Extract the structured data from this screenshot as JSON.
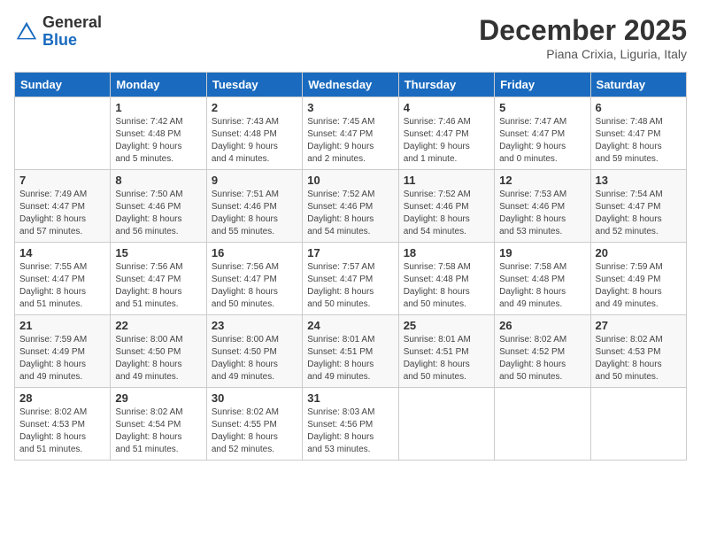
{
  "header": {
    "logo_line1": "General",
    "logo_line2": "Blue",
    "month_title": "December 2025",
    "location": "Piana Crixia, Liguria, Italy"
  },
  "days_of_week": [
    "Sunday",
    "Monday",
    "Tuesday",
    "Wednesday",
    "Thursday",
    "Friday",
    "Saturday"
  ],
  "weeks": [
    [
      {
        "day": "",
        "info": ""
      },
      {
        "day": "1",
        "info": "Sunrise: 7:42 AM\nSunset: 4:48 PM\nDaylight: 9 hours\nand 5 minutes."
      },
      {
        "day": "2",
        "info": "Sunrise: 7:43 AM\nSunset: 4:48 PM\nDaylight: 9 hours\nand 4 minutes."
      },
      {
        "day": "3",
        "info": "Sunrise: 7:45 AM\nSunset: 4:47 PM\nDaylight: 9 hours\nand 2 minutes."
      },
      {
        "day": "4",
        "info": "Sunrise: 7:46 AM\nSunset: 4:47 PM\nDaylight: 9 hours\nand 1 minute."
      },
      {
        "day": "5",
        "info": "Sunrise: 7:47 AM\nSunset: 4:47 PM\nDaylight: 9 hours\nand 0 minutes."
      },
      {
        "day": "6",
        "info": "Sunrise: 7:48 AM\nSunset: 4:47 PM\nDaylight: 8 hours\nand 59 minutes."
      }
    ],
    [
      {
        "day": "7",
        "info": "Sunrise: 7:49 AM\nSunset: 4:47 PM\nDaylight: 8 hours\nand 57 minutes."
      },
      {
        "day": "8",
        "info": "Sunrise: 7:50 AM\nSunset: 4:46 PM\nDaylight: 8 hours\nand 56 minutes."
      },
      {
        "day": "9",
        "info": "Sunrise: 7:51 AM\nSunset: 4:46 PM\nDaylight: 8 hours\nand 55 minutes."
      },
      {
        "day": "10",
        "info": "Sunrise: 7:52 AM\nSunset: 4:46 PM\nDaylight: 8 hours\nand 54 minutes."
      },
      {
        "day": "11",
        "info": "Sunrise: 7:52 AM\nSunset: 4:46 PM\nDaylight: 8 hours\nand 54 minutes."
      },
      {
        "day": "12",
        "info": "Sunrise: 7:53 AM\nSunset: 4:46 PM\nDaylight: 8 hours\nand 53 minutes."
      },
      {
        "day": "13",
        "info": "Sunrise: 7:54 AM\nSunset: 4:47 PM\nDaylight: 8 hours\nand 52 minutes."
      }
    ],
    [
      {
        "day": "14",
        "info": "Sunrise: 7:55 AM\nSunset: 4:47 PM\nDaylight: 8 hours\nand 51 minutes."
      },
      {
        "day": "15",
        "info": "Sunrise: 7:56 AM\nSunset: 4:47 PM\nDaylight: 8 hours\nand 51 minutes."
      },
      {
        "day": "16",
        "info": "Sunrise: 7:56 AM\nSunset: 4:47 PM\nDaylight: 8 hours\nand 50 minutes."
      },
      {
        "day": "17",
        "info": "Sunrise: 7:57 AM\nSunset: 4:47 PM\nDaylight: 8 hours\nand 50 minutes."
      },
      {
        "day": "18",
        "info": "Sunrise: 7:58 AM\nSunset: 4:48 PM\nDaylight: 8 hours\nand 50 minutes."
      },
      {
        "day": "19",
        "info": "Sunrise: 7:58 AM\nSunset: 4:48 PM\nDaylight: 8 hours\nand 49 minutes."
      },
      {
        "day": "20",
        "info": "Sunrise: 7:59 AM\nSunset: 4:49 PM\nDaylight: 8 hours\nand 49 minutes."
      }
    ],
    [
      {
        "day": "21",
        "info": "Sunrise: 7:59 AM\nSunset: 4:49 PM\nDaylight: 8 hours\nand 49 minutes."
      },
      {
        "day": "22",
        "info": "Sunrise: 8:00 AM\nSunset: 4:50 PM\nDaylight: 8 hours\nand 49 minutes."
      },
      {
        "day": "23",
        "info": "Sunrise: 8:00 AM\nSunset: 4:50 PM\nDaylight: 8 hours\nand 49 minutes."
      },
      {
        "day": "24",
        "info": "Sunrise: 8:01 AM\nSunset: 4:51 PM\nDaylight: 8 hours\nand 49 minutes."
      },
      {
        "day": "25",
        "info": "Sunrise: 8:01 AM\nSunset: 4:51 PM\nDaylight: 8 hours\nand 50 minutes."
      },
      {
        "day": "26",
        "info": "Sunrise: 8:02 AM\nSunset: 4:52 PM\nDaylight: 8 hours\nand 50 minutes."
      },
      {
        "day": "27",
        "info": "Sunrise: 8:02 AM\nSunset: 4:53 PM\nDaylight: 8 hours\nand 50 minutes."
      }
    ],
    [
      {
        "day": "28",
        "info": "Sunrise: 8:02 AM\nSunset: 4:53 PM\nDaylight: 8 hours\nand 51 minutes."
      },
      {
        "day": "29",
        "info": "Sunrise: 8:02 AM\nSunset: 4:54 PM\nDaylight: 8 hours\nand 51 minutes."
      },
      {
        "day": "30",
        "info": "Sunrise: 8:02 AM\nSunset: 4:55 PM\nDaylight: 8 hours\nand 52 minutes."
      },
      {
        "day": "31",
        "info": "Sunrise: 8:03 AM\nSunset: 4:56 PM\nDaylight: 8 hours\nand 53 minutes."
      },
      {
        "day": "",
        "info": ""
      },
      {
        "day": "",
        "info": ""
      },
      {
        "day": "",
        "info": ""
      }
    ]
  ]
}
